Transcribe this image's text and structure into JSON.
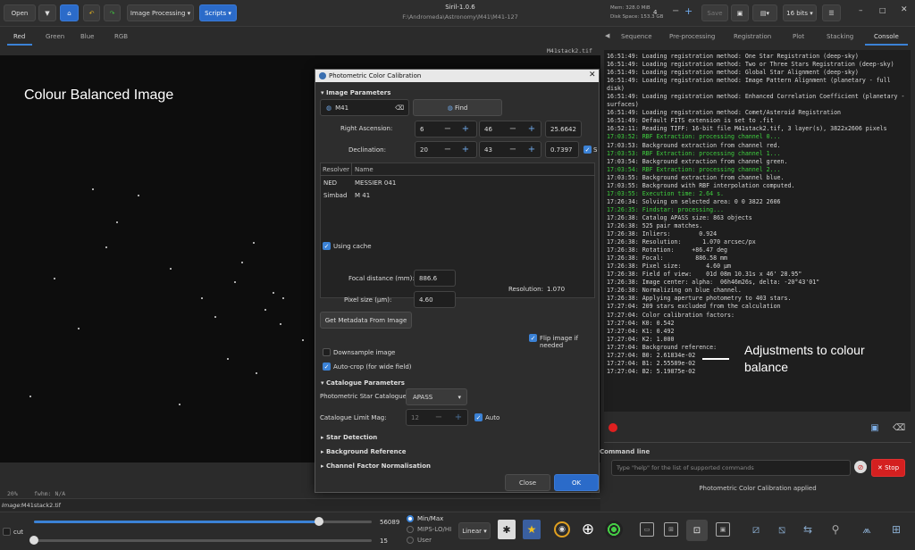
{
  "app": {
    "title": "Siril-1.0.6",
    "path": "F:\\Andromeda\\Astronomy\\M41\\M41-127"
  },
  "toolbar": {
    "open": "Open",
    "image_processing": "Image Processing",
    "scripts": "Scripts",
    "mem": "Mem: 328.0 MiB",
    "disk": "Disk Space: 153.3 GB",
    "threads": "4",
    "save": "Save",
    "bits": "16 bits"
  },
  "channel_tabs": [
    "Red",
    "Green",
    "Blue",
    "RGB"
  ],
  "image_name_tab": "M41stack2.tif",
  "image_annotation": "Colour Balanced Image",
  "viewer_status": {
    "zoom": "20%",
    "fwhm": "fwhm: N/A"
  },
  "right_tabs": [
    "Sequence",
    "Pre-processing",
    "Registration",
    "Plot",
    "Stacking",
    "Console"
  ],
  "console_lines": [
    {
      "t": "16:51:49: Loading registration method: One Star Registration (deep-sky)",
      "g": false
    },
    {
      "t": "16:51:49: Loading registration method: Two or Three Stars Registration (deep-sky)",
      "g": false
    },
    {
      "t": "16:51:49: Loading registration method: Global Star Alignment (deep-sky)",
      "g": false
    },
    {
      "t": "16:51:49: Loading registration method: Image Pattern Alignment (planetary - full disk)",
      "g": false
    },
    {
      "t": "16:51:49: Loading registration method: Enhanced Correlation Coefficient (planetary - surfaces)",
      "g": false
    },
    {
      "t": "16:51:49: Loading registration method: Comet/Asteroid Registration",
      "g": false
    },
    {
      "t": "16:51:49: Default FITS extension is set to .fit",
      "g": false
    },
    {
      "t": "16:52:11: Reading TIFF: 16-bit file M41stack2.tif, 3 layer(s), 3822x2606 pixels",
      "g": false
    },
    {
      "t": "17:03:52: RBF Extraction: processing channel 0...",
      "g": true
    },
    {
      "t": "17:03:53: Background extraction from channel red.",
      "g": false
    },
    {
      "t": "17:03:53: RBF Extraction: processing channel 1...",
      "g": true
    },
    {
      "t": "17:03:54: Background extraction from channel green.",
      "g": false
    },
    {
      "t": "17:03:54: RBF Extraction: processing channel 2...",
      "g": true
    },
    {
      "t": "17:03:55: Background extraction from channel blue.",
      "g": false
    },
    {
      "t": "17:03:55: Background with RBF interpolation computed.",
      "g": false
    },
    {
      "t": "17:03:55: Execution time: 2.64 s.",
      "g": true
    },
    {
      "t": "17:26:34: Solving on selected area: 0 0 3822 2606",
      "g": false
    },
    {
      "t": "17:26:35: Findstar: processing...",
      "g": true
    },
    {
      "t": "17:26:38: Catalog APASS size: 863 objects",
      "g": false
    },
    {
      "t": "17:26:38: 525 pair matches.",
      "g": false
    },
    {
      "t": "17:26:38: Inliers:        0.924",
      "g": false
    },
    {
      "t": "17:26:38: Resolution:      1.070 arcsec/px",
      "g": false
    },
    {
      "t": "17:26:38: Rotation:     +86.47 deg",
      "g": false
    },
    {
      "t": "17:26:38: Focal:         886.58 mm",
      "g": false
    },
    {
      "t": "17:26:38: Pixel size:       4.60 µm",
      "g": false
    },
    {
      "t": "17:26:38: Field of view:    01d 08m 10.31s x 46' 28.95\"",
      "g": false
    },
    {
      "t": "17:26:38: Image center: alpha:  06h46m26s, delta: -20°43'01\"",
      "g": false
    },
    {
      "t": "17:26:38: Normalizing on blue channel.",
      "g": false
    },
    {
      "t": "17:26:38: Applying aperture photometry to 403 stars.",
      "g": false
    },
    {
      "t": "17:27:04: 209 stars excluded from the calculation",
      "g": false
    },
    {
      "t": "17:27:04: Color calibration factors:",
      "g": false
    },
    {
      "t": "17:27:04: K0: 0.542",
      "g": false
    },
    {
      "t": "17:27:04: K1: 0.492",
      "g": false
    },
    {
      "t": "17:27:04: K2: 1.000",
      "g": false
    },
    {
      "t": "17:27:04: Background reference:",
      "g": false
    },
    {
      "t": "17:27:04: B0: 2.61834e-02",
      "g": false
    },
    {
      "t": "17:27:04: B1: 2.55589e-02",
      "g": false
    },
    {
      "t": "17:27:04: B2: 5.19875e-02",
      "g": false
    }
  ],
  "console_annotation": "Adjustments to colour balance",
  "command_line": {
    "label": "Command line",
    "placeholder": "Type \"help\" for the list of supported commands",
    "stop": "Stop"
  },
  "status_message": "Photometric Color Calibration applied",
  "image_label": "Image:",
  "image_file": "M41stack2.tif",
  "bottom": {
    "cut": "cut",
    "max_val": "56089",
    "min_val": "15",
    "mode_minmax": "Min/Max",
    "mode_mips": "MIPS-LO/HI",
    "mode_user": "User",
    "stretch": "Linear"
  },
  "dialog": {
    "title": "Photometric Color Calibration",
    "image_params": "Image Parameters",
    "object": "M41",
    "find": "Find",
    "ra_label": "Right Ascension:",
    "ra_h": "6",
    "ra_m": "46",
    "ra_s": "25.6642",
    "dec_label": "Declination:",
    "dec_d": "20",
    "dec_m": "43",
    "dec_s": "0.7397",
    "south": "S",
    "resolver_header": [
      "Resolver",
      "Name"
    ],
    "resolver_rows": [
      [
        "NED",
        "MESSIER 041"
      ],
      [
        "Simbad",
        "M  41"
      ]
    ],
    "using_cache": "Using cache",
    "focal_label": "Focal distance (mm):",
    "focal": "886.6",
    "pixel_label": "Pixel size (µm):",
    "pixel": "4.60",
    "resolution_label": "Resolution:",
    "resolution": "1.070",
    "metadata_btn": "Get Metadata From Image",
    "flip": "Flip image if needed",
    "downsample": "Downsample image",
    "autocrop": "Auto-crop (for wide field)",
    "catalogue_params": "Catalogue Parameters",
    "star_cat_label": "Photometric Star Catalogue:",
    "star_cat": "APASS",
    "limit_label": "Catalogue Limit Mag:",
    "limit": "12",
    "auto": "Auto",
    "star_detection": "Star Detection",
    "background_ref": "Background Reference",
    "channel_norm": "Channel Factor Normalisation",
    "close": "Close",
    "ok": "OK"
  }
}
